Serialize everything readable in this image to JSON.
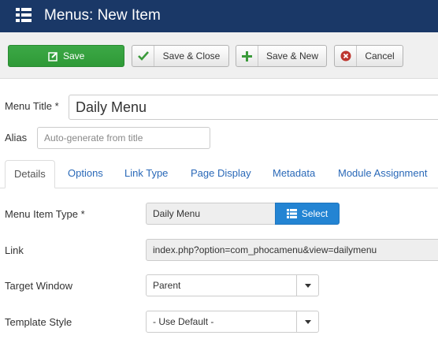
{
  "header": {
    "title": "Menus: New Item",
    "icon": "list-icon"
  },
  "toolbar": {
    "save_label": "Save",
    "save_close_label": "Save & Close",
    "save_new_label": "Save & New",
    "cancel_label": "Cancel"
  },
  "form": {
    "menu_title_label": "Menu Title *",
    "menu_title_value": "Daily Menu",
    "alias_label": "Alias",
    "alias_placeholder": "Auto-generate from title"
  },
  "tabs": [
    {
      "label": "Details",
      "active": true
    },
    {
      "label": "Options"
    },
    {
      "label": "Link Type"
    },
    {
      "label": "Page Display"
    },
    {
      "label": "Metadata"
    },
    {
      "label": "Module Assignment"
    }
  ],
  "details": {
    "menu_item_type_label": "Menu Item Type *",
    "menu_item_type_value": "Daily Menu",
    "select_label": "Select",
    "link_label": "Link",
    "link_value": "index.php?option=com_phocamenu&view=dailymenu",
    "target_window_label": "Target Window",
    "target_window_value": "Parent",
    "template_style_label": "Template Style",
    "template_style_value": "- Use Default -"
  },
  "colors": {
    "header_bg": "#1a3867",
    "save_green": "#3ca846",
    "select_blue": "#2384d3",
    "tab_link": "#2a69b8",
    "cancel_red": "#bd362f"
  }
}
